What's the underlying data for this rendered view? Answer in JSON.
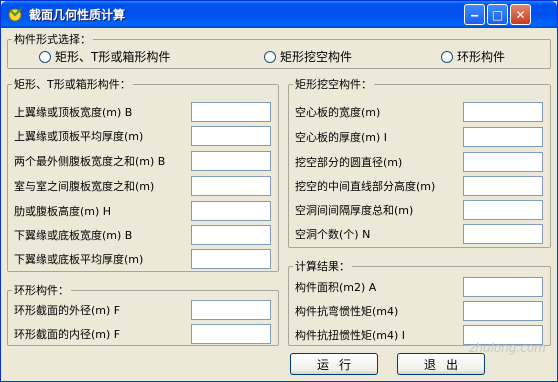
{
  "window": {
    "title": "截面几何性质计算"
  },
  "titlebar_buttons": {
    "minimize": "‒",
    "maximize": "□",
    "close": "✕"
  },
  "type_select": {
    "legend": "构件形式选择：",
    "options": [
      "矩形、T形或箱形构件",
      "矩形挖空构件",
      "环形构件"
    ]
  },
  "rect_group": {
    "legend": "矩形、T形或箱形构件：",
    "rows": [
      "上翼缘或顶板宽度(m) B",
      "上翼缘或顶板平均厚度(m)",
      "两个最外侧腹板宽度之和(m) B",
      "室与室之间腹板宽度之和(m)",
      "肋或腹板高度(m) H",
      "下翼缘或底板宽度(m) B",
      "下翼缘或底板平均厚度(m)"
    ]
  },
  "ring_group": {
    "legend": "环形构件：",
    "rows": [
      "环形截面的外径(m) F",
      "环形截面的内径(m) F"
    ]
  },
  "hollow_group": {
    "legend": "矩形挖空构件：",
    "rows": [
      "空心板的宽度(m)",
      "空心板的厚度(m) I",
      "挖空部分的圆直径(m)",
      "挖空的中间直线部分高度(m)",
      "空洞间间隔厚度总和(m)",
      "空洞个数(个) N"
    ]
  },
  "result_group": {
    "legend": "计算结果：",
    "rows": [
      "构件面积(m2) A",
      "构件抗弯惯性矩(m4)",
      "构件抗扭惯性矩(m4) I"
    ]
  },
  "actions": {
    "run": "运行",
    "exit": "退出"
  },
  "watermark": "zhulong.com"
}
